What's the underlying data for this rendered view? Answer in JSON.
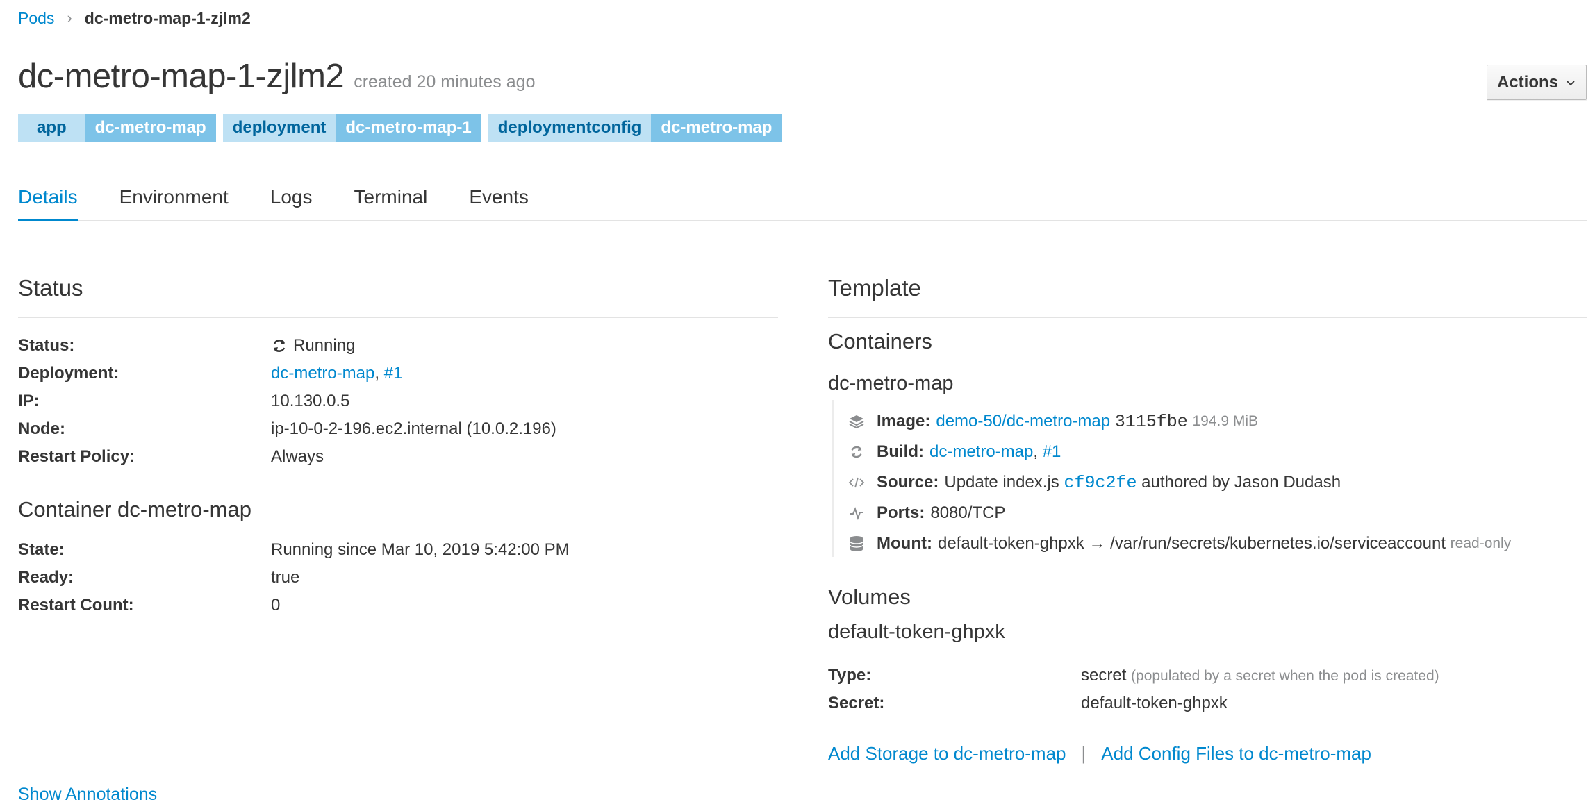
{
  "breadcrumb": {
    "parent": "Pods",
    "current": "dc-metro-map-1-zjlm2"
  },
  "header": {
    "title": "dc-metro-map-1-zjlm2",
    "created": "created 20 minutes ago",
    "actions_label": "Actions"
  },
  "labels": [
    {
      "key": "app",
      "value": "dc-metro-map"
    },
    {
      "key": "deployment",
      "value": "dc-metro-map-1"
    },
    {
      "key": "deploymentconfig",
      "value": "dc-metro-map"
    }
  ],
  "tabs": [
    "Details",
    "Environment",
    "Logs",
    "Terminal",
    "Events"
  ],
  "active_tab": "Details",
  "status": {
    "heading": "Status",
    "rows": {
      "status_label": "Status:",
      "status_value": "Running",
      "deployment_label": "Deployment:",
      "deployment_link1": "dc-metro-map",
      "deployment_comma": ",",
      "deployment_link2": "#1",
      "ip_label": "IP:",
      "ip_value": "10.130.0.5",
      "node_label": "Node:",
      "node_value": "ip-10-0-2-196.ec2.internal (10.0.2.196)",
      "restart_label": "Restart Policy:",
      "restart_value": "Always"
    }
  },
  "container_status": {
    "heading": "Container dc-metro-map",
    "state_label": "State:",
    "state_value": "Running since Mar 10, 2019 5:42:00 PM",
    "ready_label": "Ready:",
    "ready_value": "true",
    "restart_count_label": "Restart Count:",
    "restart_count_value": "0"
  },
  "template": {
    "heading": "Template",
    "containers_heading": "Containers",
    "container_name": "dc-metro-map",
    "image_label": "Image:",
    "image_link": "demo-50/dc-metro-map",
    "image_hash": "3115fbe",
    "image_size": "194.9 MiB",
    "build_label": "Build:",
    "build_link1": "dc-metro-map",
    "build_comma": ",",
    "build_link2": "#1",
    "source_label": "Source:",
    "source_text": "Update index.js",
    "source_commit": "cf9c2fe",
    "source_author": "authored by Jason Dudash",
    "ports_label": "Ports:",
    "ports_value": "8080/TCP",
    "mount_label": "Mount:",
    "mount_value": "default-token-ghpxk → /var/run/secrets/kubernetes.io/serviceaccount",
    "mount_mode": "read-only",
    "volumes_heading": "Volumes",
    "volume_name": "default-token-ghpxk",
    "type_label": "Type:",
    "type_value": "secret",
    "type_note": "(populated by a secret when the pod is created)",
    "secret_label": "Secret:",
    "secret_value": "default-token-ghpxk",
    "add_storage": "Add Storage to dc-metro-map",
    "pipe": "|",
    "add_config": "Add Config Files to dc-metro-map"
  },
  "show_annotations": "Show Annotations",
  "colors": {
    "link": "#0088ce",
    "label_key_bg": "#bee1f4",
    "label_value_bg": "#7dc3e8",
    "text": "#363636",
    "muted": "#8b8d8f"
  }
}
